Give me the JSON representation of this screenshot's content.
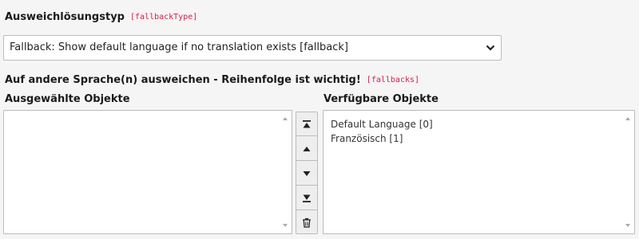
{
  "fallback_type": {
    "label": "Ausweichlösungstyp",
    "code": "[fallbackType]",
    "selected": "Fallback: Show default language if no translation exists [fallback]"
  },
  "fallbacks": {
    "label": "Auf andere Sprache(n) ausweichen - Reihenfolge ist wichtig!",
    "code": "[fallbacks]",
    "selected_header": "Ausgewählte Objekte",
    "available_header": "Verfügbare Objekte",
    "selected_items": [],
    "available_items": [
      "Default Language [0]",
      "Französisch [1]"
    ]
  },
  "icons": {
    "move_top": "move-to-top-icon",
    "move_up": "move-up-icon",
    "move_down": "move-down-icon",
    "move_bottom": "move-to-bottom-icon",
    "remove": "trash-icon",
    "dropdown": "chevron-down-icon"
  },
  "colors": {
    "code_text": "#c7254e",
    "code_bg": "#f9f2f4",
    "border": "#bbbbbb",
    "background": "#f5f5f5"
  }
}
